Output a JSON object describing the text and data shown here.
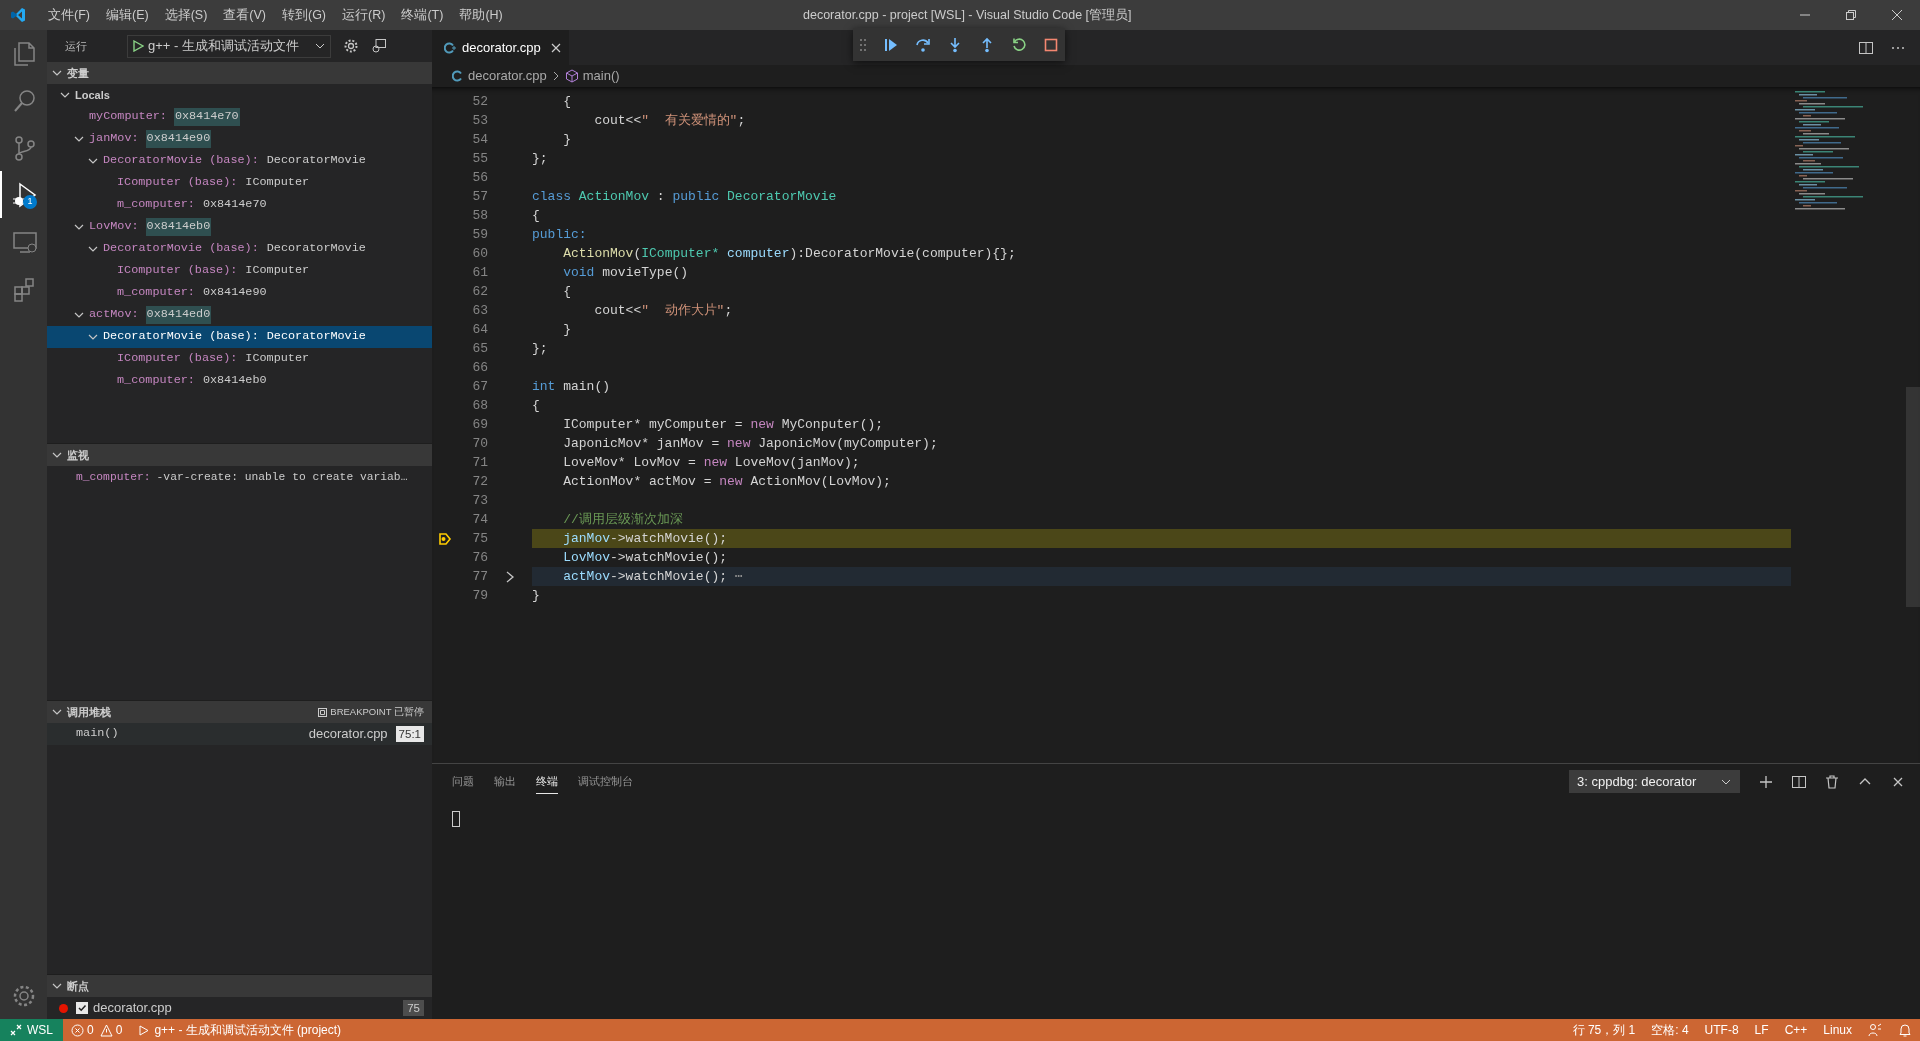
{
  "title_bar": {
    "menus": [
      "文件(F)",
      "编辑(E)",
      "选择(S)",
      "查看(V)",
      "转到(G)",
      "运行(R)",
      "终端(T)",
      "帮助(H)"
    ],
    "title": "decorator.cpp - project [WSL] - Visual Studio Code [管理员]"
  },
  "activity_bar": {
    "items": [
      {
        "kind": "files",
        "selected": false
      },
      {
        "kind": "search",
        "selected": false
      },
      {
        "kind": "scm",
        "selected": false
      },
      {
        "kind": "debug",
        "selected": true,
        "badge": "1"
      },
      {
        "kind": "remote",
        "selected": false
      },
      {
        "kind": "extensions",
        "selected": false
      }
    ]
  },
  "run_panel": {
    "label": "运行",
    "config": "g++ - 生成和调试活动文件",
    "variables": {
      "title": "变量",
      "expanded": true,
      "scopes": [
        {
          "label": "Locals",
          "expanded": true,
          "children": [
            {
              "name": "myComputer:",
              "value": "0x8414e70",
              "changed": true,
              "selected": false
            },
            {
              "name": "janMov:",
              "value": "0x8414e90",
              "changed": true,
              "selected": false,
              "expanded": true,
              "children": [
                {
                  "name": "DecoratorMovie (base):",
                  "value": "DecoratorMovie",
                  "changed": false,
                  "selected": false,
                  "expanded": true,
                  "children": [
                    {
                      "name": "IComputer (base):",
                      "value": "IComputer",
                      "changed": false,
                      "selected": false
                    },
                    {
                      "name": "m_computer:",
                      "value": "0x8414e70",
                      "changed": false,
                      "selected": false
                    }
                  ]
                }
              ]
            },
            {
              "name": "LovMov:",
              "value": "0x8414eb0",
              "changed": true,
              "selected": false,
              "expanded": true,
              "children": [
                {
                  "name": "DecoratorMovie (base):",
                  "value": "DecoratorMovie",
                  "changed": false,
                  "selected": false,
                  "expanded": true,
                  "children": [
                    {
                      "name": "IComputer (base):",
                      "value": "IComputer",
                      "changed": false,
                      "selected": false
                    },
                    {
                      "name": "m_computer:",
                      "value": "0x8414e90",
                      "changed": false,
                      "selected": false
                    }
                  ]
                }
              ]
            },
            {
              "name": "actMov:",
              "value": "0x8414ed0",
              "changed": true,
              "selected": false,
              "expanded": true,
              "children": [
                {
                  "name": "DecoratorMovie (base):",
                  "value": "DecoratorMovie",
                  "changed": false,
                  "selected": true,
                  "expanded": true,
                  "children": [
                    {
                      "name": "IComputer (base):",
                      "value": "IComputer",
                      "changed": false,
                      "selected": false
                    },
                    {
                      "name": "m_computer:",
                      "value": "0x8414eb0",
                      "changed": false,
                      "selected": false
                    }
                  ]
                }
              ]
            }
          ]
        }
      ]
    },
    "watch": {
      "title": "监视",
      "expanded": true,
      "items": [
        {
          "name": "m_computer:",
          "value": "-var-create: unable to create variab…"
        }
      ]
    },
    "call_stack": {
      "title": "调用堆栈",
      "expanded": true,
      "status": "BREAKPOINT 已暂停",
      "frames": [
        {
          "name": "main()",
          "file": "decorator.cpp",
          "position": "75:1"
        }
      ]
    },
    "breakpoints": {
      "title": "断点",
      "expanded": true,
      "items": [
        {
          "file": "decorator.cpp",
          "checked": true,
          "count": "75"
        }
      ]
    }
  },
  "editor": {
    "tabs": [
      {
        "label": "decorator.cpp",
        "selected": true
      }
    ],
    "breadcrumbs": [
      "decorator.cpp",
      "main()"
    ],
    "debug_toolbar": [
      {
        "kind": "continue"
      },
      {
        "kind": "step-over"
      },
      {
        "kind": "step-into"
      },
      {
        "kind": "step-out"
      },
      {
        "kind": "restart"
      },
      {
        "kind": "stop"
      }
    ],
    "lines": [
      {
        "n": "52",
        "kind": "plain",
        "tokens": [
          {
            "kind": "plain",
            "text": "    {"
          }
        ]
      },
      {
        "n": "53",
        "kind": "plain",
        "tokens": [
          {
            "kind": "plain",
            "text": "        cout<<"
          },
          {
            "kind": "string",
            "text": "\"  有关爱情的\""
          },
          {
            "kind": "plain",
            "text": ";"
          }
        ]
      },
      {
        "n": "54",
        "kind": "plain",
        "tokens": [
          {
            "kind": "plain",
            "text": "    }"
          }
        ]
      },
      {
        "n": "55",
        "kind": "plain",
        "tokens": [
          {
            "kind": "plain",
            "text": "};"
          }
        ]
      },
      {
        "n": "56",
        "kind": "plain"
      },
      {
        "n": "57",
        "kind": "plain",
        "tokens": [
          {
            "kind": "keyword",
            "text": "class "
          },
          {
            "kind": "type",
            "text": "ActionMov"
          },
          {
            "kind": "plain",
            "text": " : "
          },
          {
            "kind": "keyword",
            "text": "public "
          },
          {
            "kind": "type",
            "text": "DecoratorMovie"
          }
        ]
      },
      {
        "n": "58",
        "kind": "plain",
        "tokens": [
          {
            "kind": "plain",
            "text": "{"
          }
        ]
      },
      {
        "n": "59",
        "kind": "plain",
        "tokens": [
          {
            "kind": "keyword",
            "text": "public:"
          }
        ]
      },
      {
        "n": "60",
        "kind": "plain",
        "tokens": [
          {
            "kind": "function",
            "text": "    ActionMov"
          },
          {
            "kind": "plain",
            "text": "("
          },
          {
            "kind": "type",
            "text": "IComputer* "
          },
          {
            "kind": "variable",
            "text": "computer"
          },
          {
            "kind": "plain",
            "text": "):DecoratorMovie(computer){};"
          }
        ]
      },
      {
        "n": "61",
        "kind": "plain",
        "tokens": [
          {
            "kind": "keyword",
            "text": "    void"
          },
          {
            "kind": "plain",
            "text": " movieType()"
          }
        ]
      },
      {
        "n": "62",
        "kind": "plain",
        "tokens": [
          {
            "kind": "plain",
            "text": "    {"
          }
        ]
      },
      {
        "n": "63",
        "kind": "plain",
        "tokens": [
          {
            "kind": "plain",
            "text": "        cout<<"
          },
          {
            "kind": "string",
            "text": "\"  动作大片\""
          },
          {
            "kind": "plain",
            "text": ";"
          }
        ]
      },
      {
        "n": "64",
        "kind": "plain",
        "tokens": [
          {
            "kind": "plain",
            "text": "    }"
          }
        ]
      },
      {
        "n": "65",
        "kind": "plain",
        "tokens": [
          {
            "kind": "plain",
            "text": "};"
          }
        ]
      },
      {
        "n": "66",
        "kind": "plain"
      },
      {
        "n": "67",
        "kind": "plain",
        "tokens": [
          {
            "kind": "keyword",
            "text": "int"
          },
          {
            "kind": "plain",
            "text": " main()"
          }
        ]
      },
      {
        "n": "68",
        "kind": "plain",
        "tokens": [
          {
            "kind": "plain",
            "text": "{"
          }
        ]
      },
      {
        "n": "69",
        "kind": "plain",
        "tokens": [
          {
            "kind": "plain",
            "text": "    IComputer* myComputer = "
          },
          {
            "kind": "control",
            "text": "new"
          },
          {
            "kind": "plain",
            "text": " MyConputer();"
          }
        ]
      },
      {
        "n": "70",
        "kind": "plain",
        "tokens": [
          {
            "kind": "plain",
            "text": "    JaponicMov* janMov = "
          },
          {
            "kind": "control",
            "text": "new"
          },
          {
            "kind": "plain",
            "text": " JaponicMov(myComputer);"
          }
        ]
      },
      {
        "n": "71",
        "kind": "plain",
        "tokens": [
          {
            "kind": "plain",
            "text": "    LoveMov* LovMov = "
          },
          {
            "kind": "control",
            "text": "new"
          },
          {
            "kind": "plain",
            "text": " LoveMov(janMov);"
          }
        ]
      },
      {
        "n": "72",
        "kind": "plain",
        "tokens": [
          {
            "kind": "plain",
            "text": "    ActionMov* actMov = "
          },
          {
            "kind": "control",
            "text": "new"
          },
          {
            "kind": "plain",
            "text": " ActionMov(LovMov);"
          }
        ]
      },
      {
        "n": "73",
        "kind": "plain"
      },
      {
        "n": "74",
        "kind": "plain",
        "tokens": [
          {
            "kind": "comment",
            "text": "    //调用层级渐次加深"
          }
        ]
      },
      {
        "n": "75",
        "kind": "paused",
        "tokens": [
          {
            "kind": "variable",
            "text": "    janMov"
          },
          {
            "kind": "plain",
            "text": "->watchMovie();"
          }
        ]
      },
      {
        "n": "76",
        "kind": "plain",
        "tokens": [
          {
            "kind": "variable",
            "text": "    LovMov"
          },
          {
            "kind": "plain",
            "text": "->watchMovie();"
          }
        ]
      },
      {
        "n": "77",
        "kind": "folded",
        "tokens": [
          {
            "kind": "variable",
            "text": "    actMov"
          },
          {
            "kind": "plain",
            "text": "->watchMovie();"
          },
          {
            "kind": "fold",
            "text": "⋯"
          }
        ]
      },
      {
        "n": "79",
        "kind": "plain",
        "tokens": [
          {
            "kind": "plain",
            "text": "}"
          }
        ]
      }
    ]
  },
  "panel": {
    "tabs": [
      {
        "label": "问题",
        "selected": false
      },
      {
        "label": "输出",
        "selected": false
      },
      {
        "label": "终端",
        "selected": true
      },
      {
        "label": "调试控制台",
        "selected": false
      }
    ],
    "terminal": "3: cppdbg: decorator"
  },
  "status_bar": {
    "remote": "WSL",
    "errors": "0",
    "warnings": "0",
    "launch": "g++ - 生成和调试活动文件 (project)",
    "right": [
      "行 75，列 1",
      "空格: 4",
      "UTF-8",
      "LF",
      "C++",
      "Linux"
    ]
  }
}
